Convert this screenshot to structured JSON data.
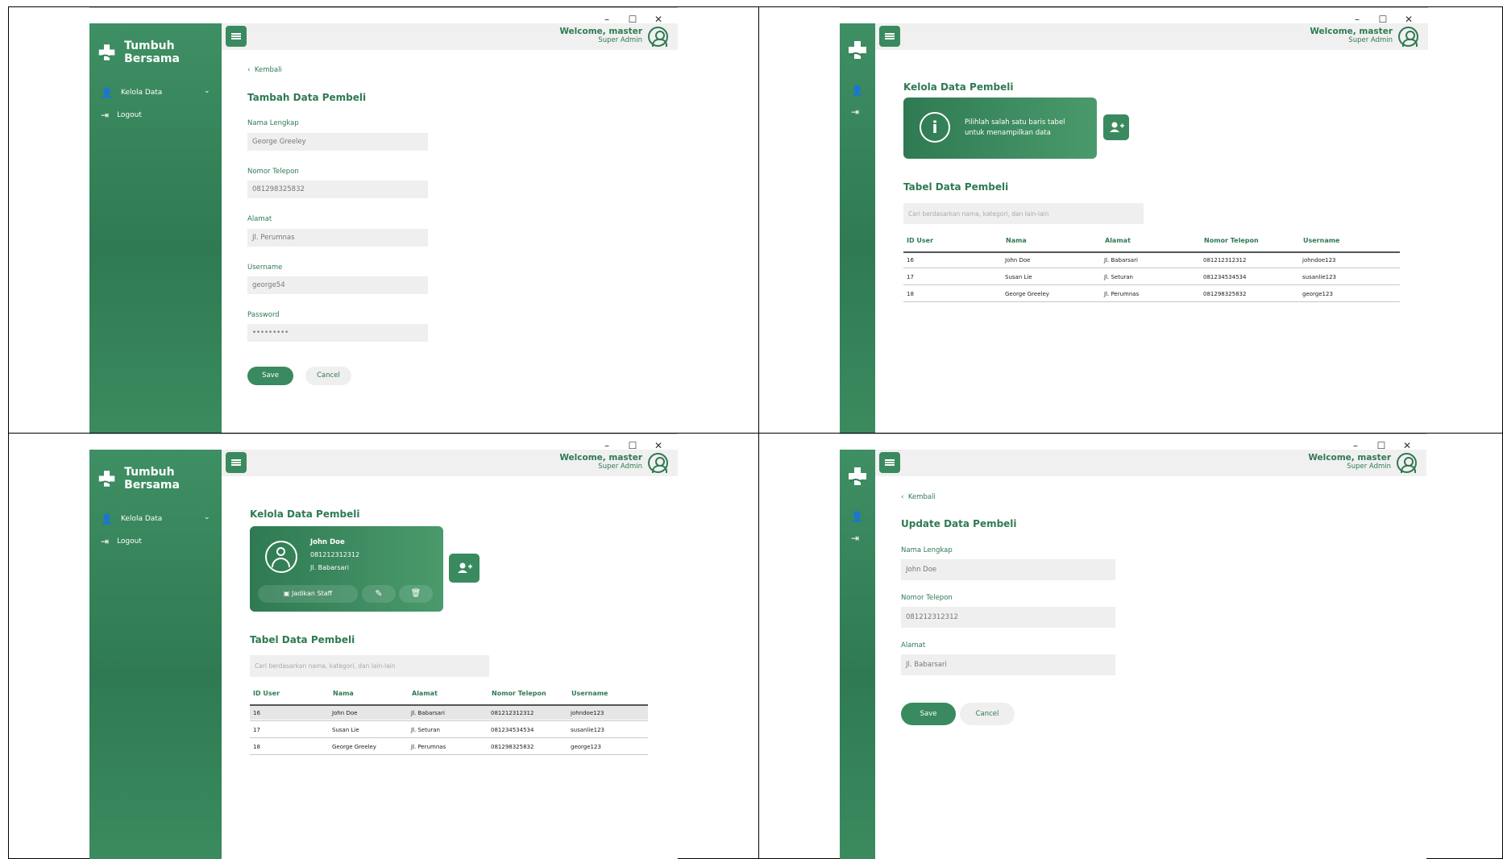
{
  "brand": {
    "name": "Tumbuh Bersama"
  },
  "sidebar": {
    "kelola_label": "Kelola Data",
    "logout_label": "Logout",
    "chevron": "⌄"
  },
  "header": {
    "welcome": "Welcome, master",
    "role": "Super Admin"
  },
  "window_controls": {
    "minimize": "–",
    "maximize": "☐",
    "close": "✕"
  },
  "back_label": "Kembali",
  "add_form": {
    "title": "Tambah Data Pembeli",
    "fields": [
      {
        "label": "Nama Lengkap",
        "value": "George Greeley"
      },
      {
        "label": "Nomor Telepon",
        "value": "081298325832"
      },
      {
        "label": "Alamat",
        "value": "Jl. Perumnas"
      },
      {
        "label": "Username",
        "value": "george54"
      },
      {
        "label": "Password",
        "value": "•••••••••"
      }
    ],
    "save": "Save",
    "cancel": "Cancel"
  },
  "manage": {
    "title": "Kelola Data Pembeli",
    "info_text_1": "Pilihlah salah satu baris tabel",
    "info_text_2": "untuk menampilkan data",
    "table_title": "Tabel Data Pembeli",
    "search_placeholder": "Cari berdasarkan nama, kategori, dan lain-lain",
    "columns": [
      "ID User",
      "Nama",
      "Alamat",
      "Nomor Telepon",
      "Username"
    ],
    "rows": [
      [
        "16",
        "John Doe",
        "Jl. Babarsari",
        "081212312312",
        "johndoe123"
      ],
      [
        "17",
        "Susan Lie",
        "Jl. Seturan",
        "081234534534",
        "susanlie123"
      ],
      [
        "18",
        "George Greeley",
        "Jl. Perumnas",
        "081298325832",
        "george123"
      ]
    ]
  },
  "selected": {
    "name": "John Doe",
    "phone": "081212312312",
    "address": "Jl. Babarsari",
    "make_staff": "Jadikan Staff"
  },
  "update_form": {
    "title": "Update Data Pembeli",
    "fields": [
      {
        "label": "Nama Lengkap",
        "value": "John Doe"
      },
      {
        "label": "Nomor Telepon",
        "value": "081212312312"
      },
      {
        "label": "Alamat",
        "value": "Jl. Babarsari"
      }
    ],
    "save": "Save",
    "cancel": "Cancel"
  },
  "colors": {
    "primary": "#2f7a52",
    "accent": "#3a8a5f",
    "input_bg": "#efefef"
  }
}
